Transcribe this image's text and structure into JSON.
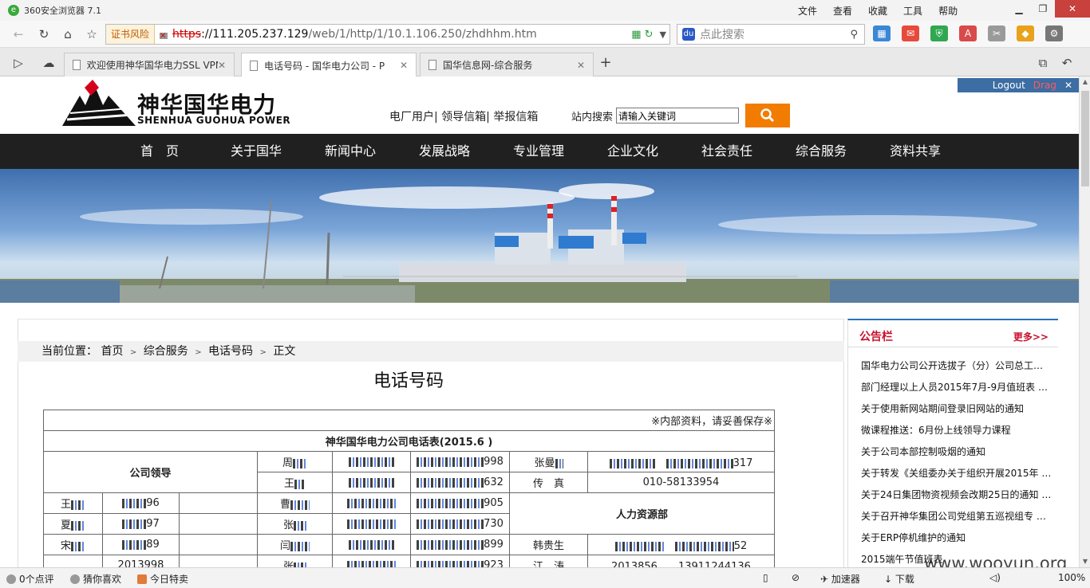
{
  "browser": {
    "title": "360安全浏览器 7.1",
    "menu": [
      "文件",
      "查看",
      "收藏",
      "工具",
      "帮助"
    ],
    "cert_warning": "证书风险",
    "url_https": "https",
    "url_host": "://111.205.237.129",
    "url_path": "/web/1/http/1/10.1.106.250/zhdhhm.htm",
    "search_placeholder": "点此搜索",
    "tabs": [
      {
        "title": "欢迎使用神华国华电力SSL VPN"
      },
      {
        "title": "电话号码 - 国华电力公司 - P"
      },
      {
        "title": "国华信息网-综合服务"
      }
    ],
    "new_tab": "+"
  },
  "page": {
    "logout": "Logout",
    "drag": "Drag",
    "logo_cn": "神华国华电力",
    "logo_en": "SHENHUA GUOHUA POWER",
    "top_links": "电厂用户| 领导信箱| 举报信箱",
    "site_search_label": "站内搜索",
    "site_search_value": "请输入关键词",
    "nav": [
      "首　页",
      "关于国华",
      "新闻中心",
      "发展战略",
      "专业管理",
      "企业文化",
      "社会责任",
      "综合服务",
      "资料共享"
    ],
    "breadcrumb": {
      "label": "当前位置：",
      "items": [
        "首页",
        "综合服务",
        "电话号码",
        "正文"
      ]
    },
    "doc_title": "电话号码",
    "table": {
      "note": "※内部资料，请妥善保存※",
      "title": "神华国华电力公司电话表(2015.6 )",
      "group_leaders": "公司领导",
      "group_hr": "人力资源部",
      "leaders_right": [
        {
          "name": "周",
          "ext_tail": "998"
        },
        {
          "name": "王",
          "ext_tail": "632"
        }
      ],
      "col3_top": [
        {
          "name": "张曼",
          "tail": "317"
        },
        {
          "name": "传　真",
          "tail": "010-58133954"
        }
      ],
      "rows": [
        {
          "a_name": "王",
          "a_num": "96",
          "b_name": "曹",
          "b_tail": "905"
        },
        {
          "a_name": "夏",
          "a_num": "97",
          "b_name": "张",
          "b_tail": "730"
        },
        {
          "a_name": "宋",
          "a_num": "89",
          "b_name": "闫",
          "b_tail": "899",
          "c_name": "韩贵生",
          "c_tail": "52"
        },
        {
          "a_name": "",
          "a_num": "2013998",
          "b_name": "张",
          "b_tail": "923",
          "c_name": "江　涛",
          "c_num": "2013856",
          "c_tail": "13911244136"
        }
      ]
    },
    "notice": {
      "title": "公告栏",
      "more": "更多>>",
      "items": [
        "国华电力公司公开选拔子（分）公司总工…",
        "部门经理以上人员2015年7月-9月值班表 …",
        "关于使用新网站期间登录旧网站的通知",
        "微课程推送：6月份上线领导力课程",
        "关于公司本部控制吸烟的通知",
        "关于转发《关组委办关于组织开展2015年 …",
        "关于24日集团物资视频会改期25日的通知 …",
        "关于召开神华集团公司党组第五巡视组专 …",
        "关于ERP停机维护的通知",
        "2015端午节值班表"
      ]
    }
  },
  "statusbar": {
    "comments": "0个点评",
    "guess": "猜你喜欢",
    "deals": "今日特卖",
    "accelerator": "加速器",
    "download": "下载",
    "zoom": "100%"
  },
  "watermark": "www.wooyun.org",
  "colors": {
    "nav_bg": "#202020",
    "accent_orange": "#f27c00",
    "notice_red": "#c8102e"
  }
}
